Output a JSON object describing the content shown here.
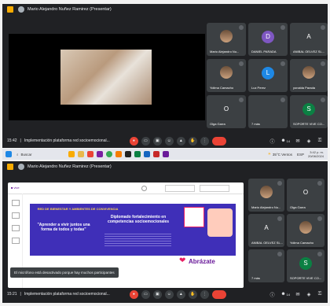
{
  "top": {
    "presenter": "Mario Alejandro Nuñez Ramirez (Presentar)",
    "participants": [
      {
        "name": "Mario Alejandro Nu...",
        "type": "photo"
      },
      {
        "name": "DANIEL PARADA",
        "type": "initial",
        "initial": "D",
        "color": "#7e57c2"
      },
      {
        "name": "ANIBAL OELVEZ SL...",
        "type": "initial",
        "initial": "A",
        "color": "#3c4043"
      },
      {
        "name": "Yolima Camacho",
        "type": "photo"
      },
      {
        "name": "Luz Perez",
        "type": "initial",
        "initial": "L",
        "color": "#1e88e5"
      },
      {
        "name": "yonalda Parada",
        "type": "photo"
      },
      {
        "name": "Olga Garra",
        "type": "initial",
        "initial": "O",
        "color": "#3c4043"
      },
      {
        "name": "7 más",
        "type": "initial",
        "initial": "",
        "color": "#3c4043"
      },
      {
        "name": "SOPORTE VIVE CO...",
        "type": "initial",
        "initial": "S",
        "color": "#0b8043"
      }
    ],
    "time": "15:42",
    "meeting_title": "Implementación plataforma red socioemocional...",
    "badge": "14"
  },
  "taskbar": {
    "search_placeholder": "Buscar",
    "weather": "35°C Ventos",
    "lang": "ESP",
    "clock_time": "3:42 p. m.",
    "clock_date": "20/06/2024"
  },
  "bottom": {
    "presenter": "Mario Alejandro Nuñez Ramirez (Presentar)",
    "slide": {
      "heading": "RED DE BIENESTAR Y AMBIENTES DE CONVIVENCIA",
      "quote": "\"Aprender a vivir juntos una forma de todos y todas\"",
      "diploma": "Diplomado fortalecimiento en competencias socioemocionales",
      "brand": "Abrázate"
    },
    "participants": [
      {
        "name": "Mario Alejandro Nu...",
        "type": "photo"
      },
      {
        "name": "Olga Garra",
        "type": "initial",
        "initial": "O",
        "color": "#3c4043"
      },
      {
        "name": "ANIBAL OELVEZ SL...",
        "type": "initial",
        "initial": "A",
        "color": "#3c4043"
      },
      {
        "name": "Yolima Camacho",
        "type": "photo"
      },
      {
        "name": "7 más",
        "type": "initial",
        "initial": "",
        "color": "#3c4043"
      },
      {
        "name": "SOPORTE VIVE CO...",
        "type": "initial",
        "initial": "S",
        "color": "#0b8043"
      }
    ],
    "toast": "El micrófono está desactivado porque hay muchos participantes",
    "time": "15:21",
    "meeting_title": "Implementación plataforma red socioemocional...",
    "badge": "14"
  }
}
